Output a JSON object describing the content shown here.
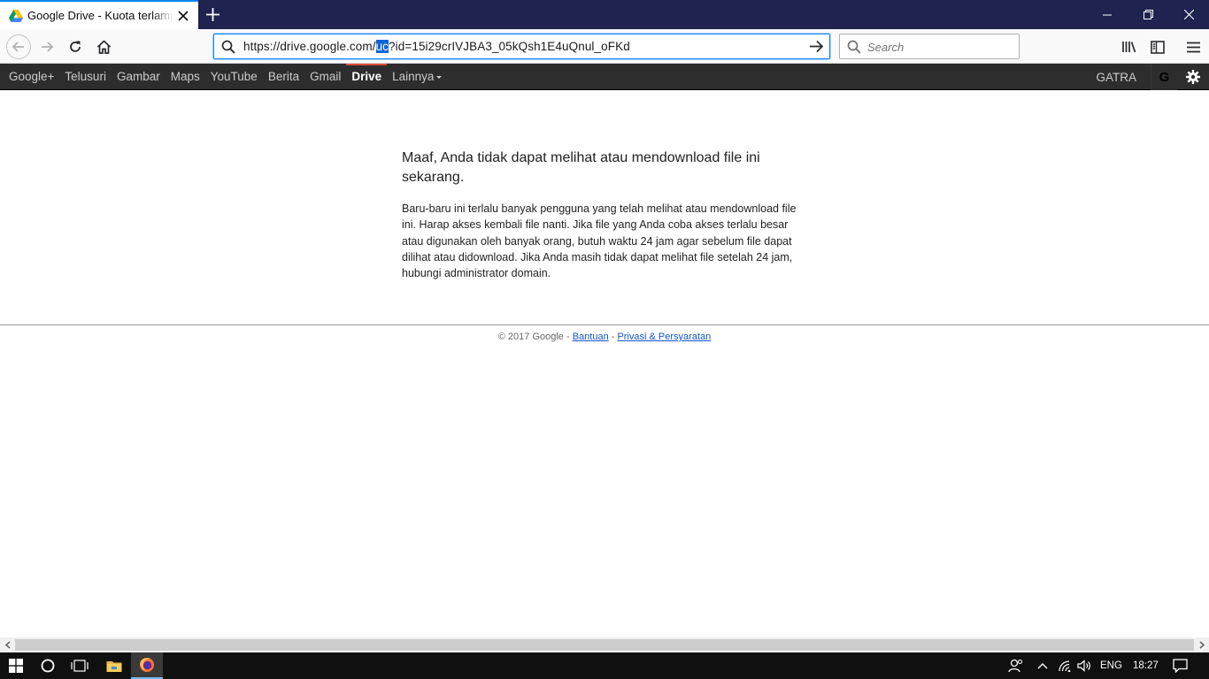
{
  "window": {
    "tab_title": "Google Drive - Kuota terlampaui",
    "colors": {
      "titlebar": "#1e2350",
      "accent": "#0a84ff"
    }
  },
  "navbar": {
    "url_before": "https://drive.google.com/",
    "url_selected": "uc",
    "url_after": "?id=15i29crIVJBA3_05kQsh1E4uQnul_oFKd",
    "search_placeholder": "Search"
  },
  "gbar": {
    "items": [
      "Google+",
      "Telusuri",
      "Gambar",
      "Maps",
      "YouTube",
      "Berita",
      "Gmail",
      "Drive",
      "Lainnya"
    ],
    "active_item": "Drive",
    "user": "GATRA",
    "profile_letter": "G"
  },
  "main": {
    "heading": "Maaf, Anda tidak dapat melihat atau mendownload file ini sekarang.",
    "message": "Baru-baru ini terlalu banyak pengguna yang telah melihat atau mendownload file ini. Harap akses kembali file nanti. Jika file yang Anda coba akses terlalu besar atau digunakan oleh banyak orang, butuh waktu 24 jam agar sebelum file dapat dilihat atau didownload. Jika Anda masih tidak dapat melihat file setelah 24 jam, hubungi administrator domain."
  },
  "footer": {
    "copyright": "© 2017 Google - ",
    "separator": " - ",
    "help_link": "Bantuan",
    "privacy_link": "Privasi & Persyaratan"
  },
  "taskbar": {
    "language": "ENG",
    "time": "18:27"
  }
}
